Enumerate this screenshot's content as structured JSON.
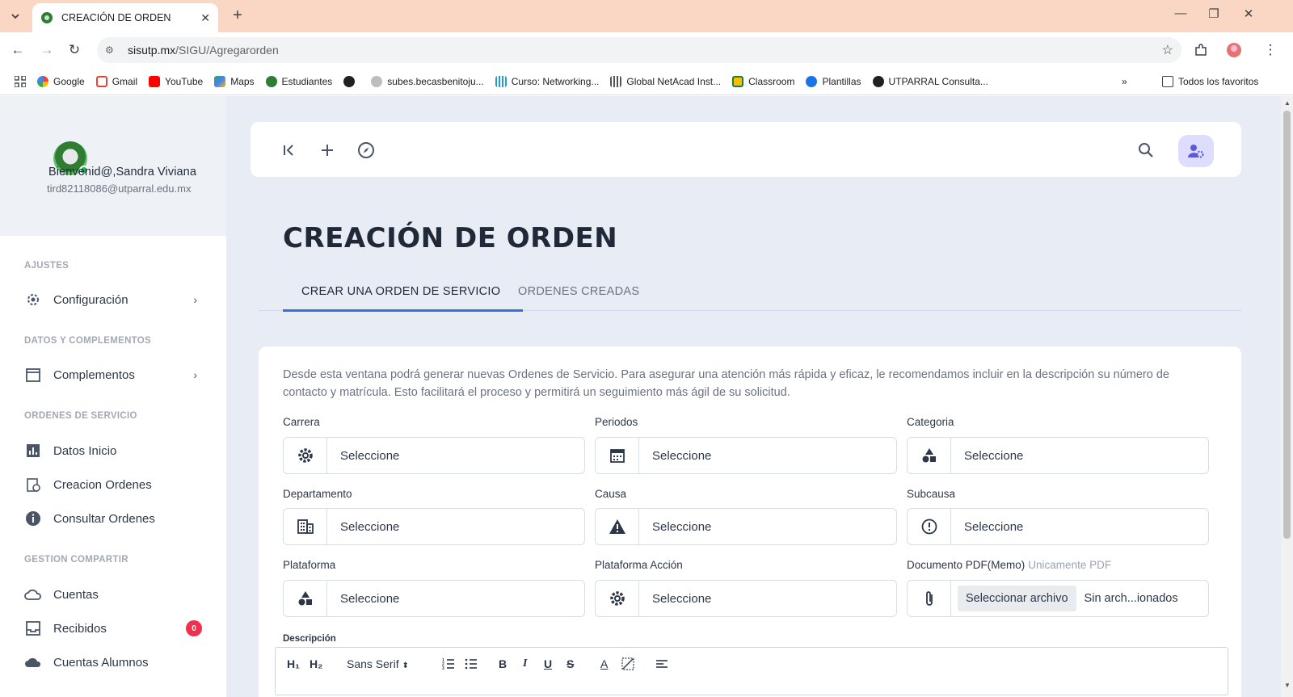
{
  "browser": {
    "tab_title": "CREACIÓN DE ORDEN",
    "url_host": "sisutp.mx",
    "url_path": "/SIGU/Agregarorden",
    "bookmarks": [
      "Google",
      "Gmail",
      "YouTube",
      "Maps",
      "Estudiantes",
      "",
      "subes.becasbenitoju...",
      "Curso: Networking...",
      "Global NetAcad Inst...",
      "Classroom",
      "Plantillas",
      "UTPARRAL Consulta..."
    ],
    "all_bookmarks_label": "Todos los favoritos",
    "colors": {
      "tabstrip": "#fad7c4"
    }
  },
  "sidebar": {
    "welcome": "Bienvenid@,Sandra Viviana",
    "email": "tird82118086@utparral.edu.mx",
    "sections": {
      "ajustes": "AJUSTES",
      "datos": "DATOS Y COMPLEMENTOS",
      "ordenes": "ORDENES DE SERVICIO",
      "gestion": "GESTION COMPARTIR"
    },
    "items": {
      "configuracion": "Configuración",
      "complementos": "Complementos",
      "datos_inicio": "Datos Inicio",
      "creacion_ordenes": "Creacion Ordenes",
      "consultar_ordenes": "Consultar Ordenes",
      "cuentas": "Cuentas",
      "recibidos": "Recibidos",
      "recibidos_badge": "0",
      "cuentas_alumnos": "Cuentas Alumnos"
    }
  },
  "main": {
    "title": "CREACIÓN DE ORDEN",
    "tabs": {
      "create": "CREAR UNA ORDEN DE SERVICIO",
      "created": "ORDENES CREADAS"
    },
    "intro": "Desde esta ventana podrá generar nuevas Ordenes de Servicio. Para asegurar una atención más rápida y eficaz, le recomendamos incluir en la descripción su número de contacto y matrícula. Esto facilitará el proceso y permitirá un seguimiento más ágil de su solicitud.",
    "fields": {
      "carrera": {
        "label": "Carrera",
        "value": "Seleccione"
      },
      "periodos": {
        "label": "Periodos",
        "value": "Seleccione"
      },
      "categoria": {
        "label": "Categoria",
        "value": "Seleccione"
      },
      "departamento": {
        "label": "Departamento",
        "value": "Seleccione"
      },
      "causa": {
        "label": "Causa",
        "value": "Seleccione"
      },
      "subcausa": {
        "label": "Subcausa",
        "value": "Seleccione"
      },
      "plataforma": {
        "label": "Plataforma",
        "value": "Seleccione"
      },
      "plataforma_accion": {
        "label": "Plataforma Acción",
        "value": "Seleccione"
      },
      "documento": {
        "label": "Documento PDF(Memo)",
        "hint": "Unicamente PDF",
        "button": "Seleccionar archivo",
        "status": "Sin arch...ionados"
      }
    },
    "descripcion_label": "Descripción",
    "editor": {
      "h1": "H₁",
      "h2": "H₂",
      "font": "Sans Serif",
      "bold": "B",
      "italic": "I",
      "underline": "U",
      "strike": "S",
      "color": "A"
    },
    "accent": "#3b6fd8"
  }
}
